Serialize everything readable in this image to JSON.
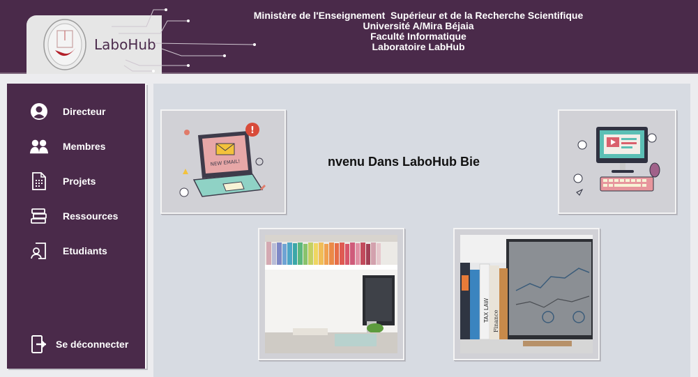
{
  "header": {
    "brand": "LaboHub",
    "lines": [
      "Ministère de l'Enseignement  Supérieur et de la Recherche Scientifique",
      "Université A/Mira Béjaia",
      "Faculté Informatique",
      "Laboratoire LabHub"
    ]
  },
  "sidebar": {
    "items": [
      {
        "label": "Directeur",
        "icon": "user-circle-icon"
      },
      {
        "label": "Membres",
        "icon": "users-icon"
      },
      {
        "label": "Projets",
        "icon": "document-icon"
      },
      {
        "label": "Ressources",
        "icon": "books-icon"
      },
      {
        "label": "Etudiants",
        "icon": "student-icon"
      }
    ],
    "logout": {
      "label": "Se déconnecter",
      "icon": "logout-icon"
    }
  },
  "main": {
    "welcome": "nvenu Dans LaboHub Bie",
    "images": [
      {
        "name": "email-laptop-illustration"
      },
      {
        "name": "desktop-computer-illustration"
      },
      {
        "name": "bookshelf-desk-photo"
      },
      {
        "name": "binders-monitor-photo"
      }
    ]
  },
  "colors": {
    "primary": "#4a2a4a",
    "main_bg": "#d7dbe2",
    "card_bg": "#d1d1d6"
  }
}
